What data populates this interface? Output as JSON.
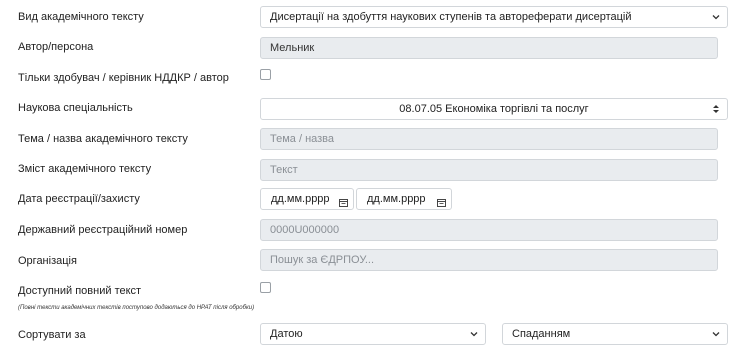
{
  "form": {
    "type": {
      "label": "Вид академічного тексту",
      "value": "Дисертації на здобуття наукових ступенів та автореферати дисертацій"
    },
    "author": {
      "label": "Автор/персона",
      "value": "Мельник"
    },
    "only_applicant": {
      "label": "Тільки здобувач / керівник НДДКР / автор",
      "checked": false
    },
    "specialty": {
      "label": "Наукова спеціальність",
      "value": "08.07.05 Економіка торгівлі та послуг"
    },
    "title": {
      "label": "Тема / назва академічного тексту",
      "placeholder": "Тема / назва"
    },
    "content": {
      "label": "Зміст академічного тексту",
      "placeholder": "Текст"
    },
    "date": {
      "label": "Дата реєстрації/захисту",
      "from_placeholder": "дд.мм.рррр",
      "to_placeholder": "дд.мм.рррр"
    },
    "reg_number": {
      "label": "Державний реєстраційний номер",
      "placeholder": "0000U000000"
    },
    "organization": {
      "label": "Організація",
      "placeholder": "Пошук за ЄДРПОУ..."
    },
    "full_text": {
      "label": "Доступний повний текст",
      "checked": false,
      "note": "(Повні тексти академічних текстів поступово додаються до НРАТ після обробки)"
    },
    "sort": {
      "label": "Сортувати за",
      "field_value": "Датою",
      "order_value": "Спаданням"
    }
  },
  "icons": {
    "select_caret": "chevron-down-icon",
    "spinner_caret": "updown-icon",
    "calendar": "calendar-icon"
  }
}
